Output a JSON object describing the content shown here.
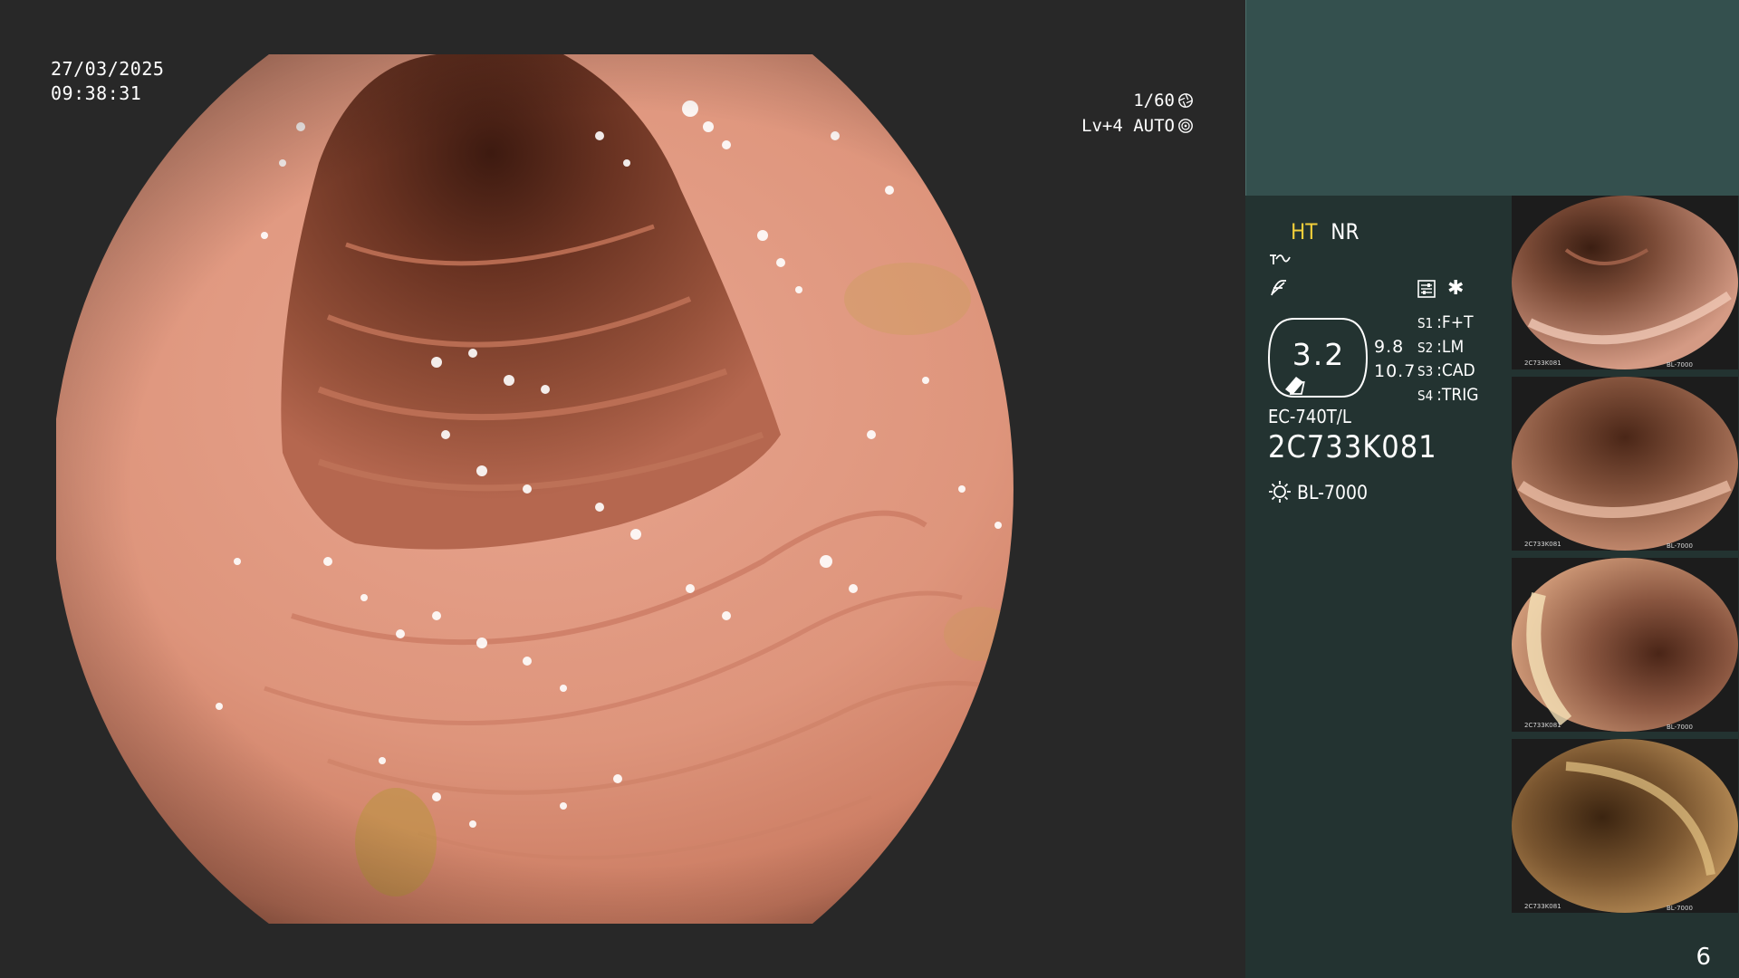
{
  "header": {
    "date": "27/03/2025",
    "time": "09:38:31"
  },
  "camera": {
    "shutter": "1/60",
    "shutter_icon": "aperture-icon",
    "level": "Lv+4",
    "exposure": "AUTO",
    "exposure_icon": "iris-icon"
  },
  "image_modes": {
    "ht": "HT",
    "nr": "NR",
    "ht_color": "#f3cf3a",
    "icons": [
      "enhance-curve-icon",
      "filter-icon",
      "settings-panel-icon",
      "asterisk-icon"
    ]
  },
  "zoom": {
    "value": "3.2",
    "sub_1": "9.8",
    "sub_2": "10.7"
  },
  "switches": [
    {
      "key": "S1",
      "value": "F+T"
    },
    {
      "key": "S2",
      "value": "LM"
    },
    {
      "key": "S3",
      "value": "CAD"
    },
    {
      "key": "S4",
      "value": "TRIG"
    }
  ],
  "scope": {
    "model": "EC-740T/L",
    "serial": "2C733K081",
    "light_source": "BL-7000",
    "light_icon": "light-source-icon"
  },
  "thumbnails": [
    {
      "caption_bottom": "2C733K081",
      "caption_right": "BL-7000"
    },
    {
      "caption_bottom": "2C733K081",
      "caption_right": "BL-7000"
    },
    {
      "caption_bottom": "2C733K081",
      "caption_right": "BL-7000"
    },
    {
      "caption_bottom": "2C733K081",
      "caption_right": "BL-7000"
    }
  ],
  "page": {
    "number": "6"
  },
  "colors": {
    "background": "#282828",
    "panel": "#233331",
    "panel_top": "#34504e",
    "mucosa": "#d98e75"
  }
}
